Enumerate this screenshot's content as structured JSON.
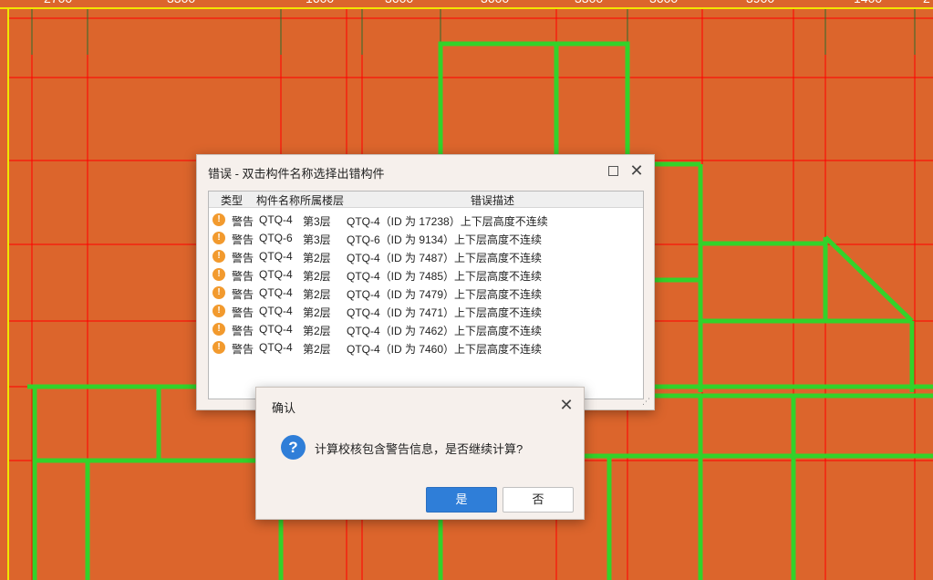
{
  "ruler": {
    "labels": [
      "2700",
      "3300",
      "1600",
      "3600",
      "3600",
      "3300",
      "3600",
      "3900",
      "1400",
      "2"
    ]
  },
  "error_window": {
    "title": "错误 - 双击构件名称选择出错构件",
    "columns": {
      "type": "类型",
      "name": "构件名称",
      "floor": "所属楼层",
      "desc": "错误描述"
    },
    "rows": [
      {
        "type": "警告",
        "name": "QTQ-4",
        "floor": "第3层",
        "desc": "QTQ-4（ID 为 17238）上下层高度不连续"
      },
      {
        "type": "警告",
        "name": "QTQ-6",
        "floor": "第3层",
        "desc": "QTQ-6（ID 为 9134）上下层高度不连续"
      },
      {
        "type": "警告",
        "name": "QTQ-4",
        "floor": "第2层",
        "desc": "QTQ-4（ID 为 7487）上下层高度不连续"
      },
      {
        "type": "警告",
        "name": "QTQ-4",
        "floor": "第2层",
        "desc": "QTQ-4（ID 为 7485）上下层高度不连续"
      },
      {
        "type": "警告",
        "name": "QTQ-4",
        "floor": "第2层",
        "desc": "QTQ-4（ID 为 7479）上下层高度不连续"
      },
      {
        "type": "警告",
        "name": "QTQ-4",
        "floor": "第2层",
        "desc": "QTQ-4（ID 为 7471）上下层高度不连续"
      },
      {
        "type": "警告",
        "name": "QTQ-4",
        "floor": "第2层",
        "desc": "QTQ-4（ID 为 7462）上下层高度不连续"
      },
      {
        "type": "警告",
        "name": "QTQ-4",
        "floor": "第2层",
        "desc": "QTQ-4（ID 为 7460）上下层高度不连续"
      }
    ]
  },
  "confirm_dialog": {
    "title": "确认",
    "message": "计算校核包含警告信息，是否继续计算?",
    "yes_label": "是",
    "no_label": "否"
  },
  "colors": {
    "background": "#dc652c",
    "wall_green": "#33d22a",
    "grid_red": "#ff0000",
    "ruler_yellow": "#f2e600",
    "accent_blue": "#2f7ed8",
    "warning_orange": "#f29a2e"
  }
}
